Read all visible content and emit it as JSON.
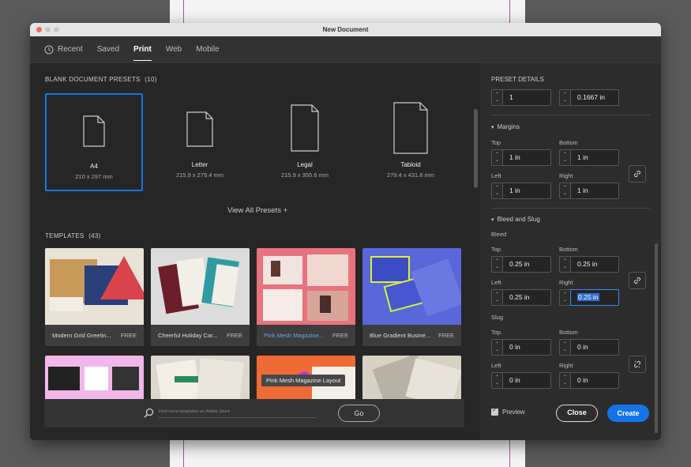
{
  "window": {
    "title": "New Document"
  },
  "tabs": [
    {
      "label": "Recent",
      "icon": "clock-icon"
    },
    {
      "label": "Saved"
    },
    {
      "label": "Print"
    },
    {
      "label": "Web"
    },
    {
      "label": "Mobile"
    }
  ],
  "active_tab": "Print",
  "blank_presets": {
    "title": "BLANK DOCUMENT PRESETS",
    "count": "(10)",
    "items": [
      {
        "name": "A4",
        "size": "210 x 297 mm"
      },
      {
        "name": "Letter",
        "size": "215.9 x 279.4 mm"
      },
      {
        "name": "Legal",
        "size": "215.9 x 355.6 mm"
      },
      {
        "name": "Tabloid",
        "size": "279.4 x 431.8 mm"
      }
    ],
    "view_all": "View All Presets +"
  },
  "templates": {
    "title": "TEMPLATES",
    "count": "(43)",
    "items": [
      {
        "name": "Modern Grid Greetin...",
        "badge": "FREE"
      },
      {
        "name": "Cheerful Holiday Car...",
        "badge": "FREE"
      },
      {
        "name": "Pink Mesh Magazine...",
        "badge": "FREE"
      },
      {
        "name": "Blue Gradient Busine...",
        "badge": "FREE"
      }
    ],
    "tooltip": "Pink Mesh Magazine Layout",
    "search_placeholder": "Find more templates on Adobe Stock",
    "go_label": "Go"
  },
  "preset_details": {
    "title": "PRESET DETAILS",
    "pages": "1",
    "columns_gutter": "0.1667 in",
    "margins": {
      "label": "Margins",
      "top_label": "Top",
      "top": "1 in",
      "bottom_label": "Bottom",
      "bottom": "1 in",
      "left_label": "Left",
      "left": "1 in",
      "right_label": "Right",
      "right": "1 in"
    },
    "bleed_slug": {
      "label": "Bleed and Slug",
      "bleed_label": "Bleed",
      "bleed_top_label": "Top",
      "bleed_top": "0.25 in",
      "bleed_bottom_label": "Bottom",
      "bleed_bottom": "0.25 in",
      "bleed_left_label": "Left",
      "bleed_left": "0.25 in",
      "bleed_right_label": "Right",
      "bleed_right": "0.25 in",
      "slug_label": "Slug",
      "slug_top_label": "Top",
      "slug_top": "0 in",
      "slug_bottom_label": "Bottom",
      "slug_bottom": "0 in",
      "slug_left_label": "Left",
      "slug_left": "0 in",
      "slug_right_label": "Right",
      "slug_right": "0 in"
    }
  },
  "footer": {
    "preview_label": "Preview",
    "close_label": "Close",
    "create_label": "Create"
  },
  "colors": {
    "accent": "#1473e6",
    "selection": "#1a73e8"
  }
}
